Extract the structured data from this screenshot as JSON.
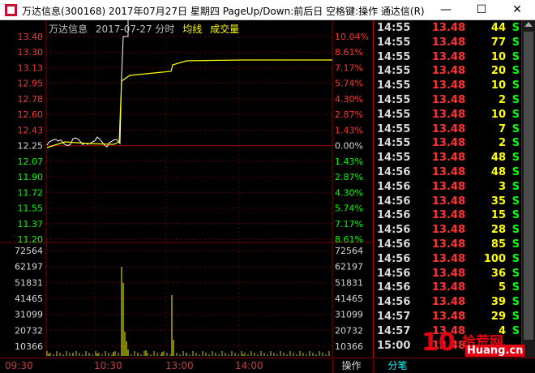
{
  "window": {
    "title": "万达信息(300168) 2017年07月27日 星期四 PageUp/Down:前后日 空格键:操作 通达信(R)",
    "minimize": "—",
    "maximize": "☐",
    "close": "✕"
  },
  "chart_header": {
    "stock": "万达信息",
    "date": "2017-07-27 分时",
    "avg_line": "均线",
    "volume": "成交量"
  },
  "price_axis": {
    "labels": [
      "13.48",
      "13.30",
      "13.13",
      "12.95",
      "12.78",
      "12.60",
      "12.43",
      "12.25",
      "12.07",
      "11.90",
      "11.72",
      "11.55",
      "11.37",
      "11.20"
    ],
    "percents": [
      "10.04%",
      "8.61%",
      "7.17%",
      "5.74%",
      "4.30%",
      "2.87%",
      "1.43%",
      "0.00%",
      "1.43%",
      "2.87%",
      "4.30%",
      "5.74%",
      "7.17%",
      "8.61%"
    ]
  },
  "volume_axis": {
    "labels": [
      "72564",
      "62197",
      "51831",
      "41465",
      "31099",
      "20732",
      "10366"
    ]
  },
  "time_axis": {
    "labels": [
      "09:30",
      "10:30",
      "13:00",
      "14:00"
    ]
  },
  "bottom_tabs": [
    "操作",
    "分笔"
  ],
  "trades": [
    {
      "time": "14:55",
      "price": "13.48",
      "vol": "44",
      "dir": "S"
    },
    {
      "time": "14:55",
      "price": "13.48",
      "vol": "77",
      "dir": "S"
    },
    {
      "time": "14:55",
      "price": "13.48",
      "vol": "10",
      "dir": "S"
    },
    {
      "time": "14:55",
      "price": "13.48",
      "vol": "20",
      "dir": "S"
    },
    {
      "time": "14:55",
      "price": "13.48",
      "vol": "10",
      "dir": "S"
    },
    {
      "time": "14:55",
      "price": "13.48",
      "vol": "2",
      "dir": "S"
    },
    {
      "time": "14:55",
      "price": "13.48",
      "vol": "10",
      "dir": "S"
    },
    {
      "time": "14:55",
      "price": "13.48",
      "vol": "7",
      "dir": "S"
    },
    {
      "time": "14:55",
      "price": "13.48",
      "vol": "2",
      "dir": "S"
    },
    {
      "time": "14:55",
      "price": "13.48",
      "vol": "48",
      "dir": "S"
    },
    {
      "time": "14:56",
      "price": "13.48",
      "vol": "48",
      "dir": "S"
    },
    {
      "time": "14:56",
      "price": "13.48",
      "vol": "3",
      "dir": "S"
    },
    {
      "time": "14:56",
      "price": "13.48",
      "vol": "35",
      "dir": "S"
    },
    {
      "time": "14:56",
      "price": "13.48",
      "vol": "15",
      "dir": "S"
    },
    {
      "time": "14:56",
      "price": "13.48",
      "vol": "28",
      "dir": "S"
    },
    {
      "time": "14:56",
      "price": "13.48",
      "vol": "85",
      "dir": "S"
    },
    {
      "time": "14:56",
      "price": "13.48",
      "vol": "100",
      "dir": "S"
    },
    {
      "time": "14:56",
      "price": "13.48",
      "vol": "36",
      "dir": "S"
    },
    {
      "time": "14:56",
      "price": "13.48",
      "vol": "5",
      "dir": "S"
    },
    {
      "time": "14:56",
      "price": "13.48",
      "vol": "39",
      "dir": "S"
    },
    {
      "time": "14:57",
      "price": "13.48",
      "vol": "29",
      "dir": "S"
    },
    {
      "time": "14:57",
      "price": "13.48",
      "vol": "4",
      "dir": "S"
    },
    {
      "time": "15:00",
      "price": "13.48",
      "vol": "",
      "dir": ""
    }
  ],
  "watermark": {
    "logo": "10",
    "text1": "拾荒网",
    "text2": "Huang.cn"
  },
  "colors": {
    "background": "#000000",
    "grid": "#800000",
    "up": "#ff3333",
    "down": "#00ff00",
    "avg_line": "#ffff00",
    "price_line": "#ffffff"
  }
}
